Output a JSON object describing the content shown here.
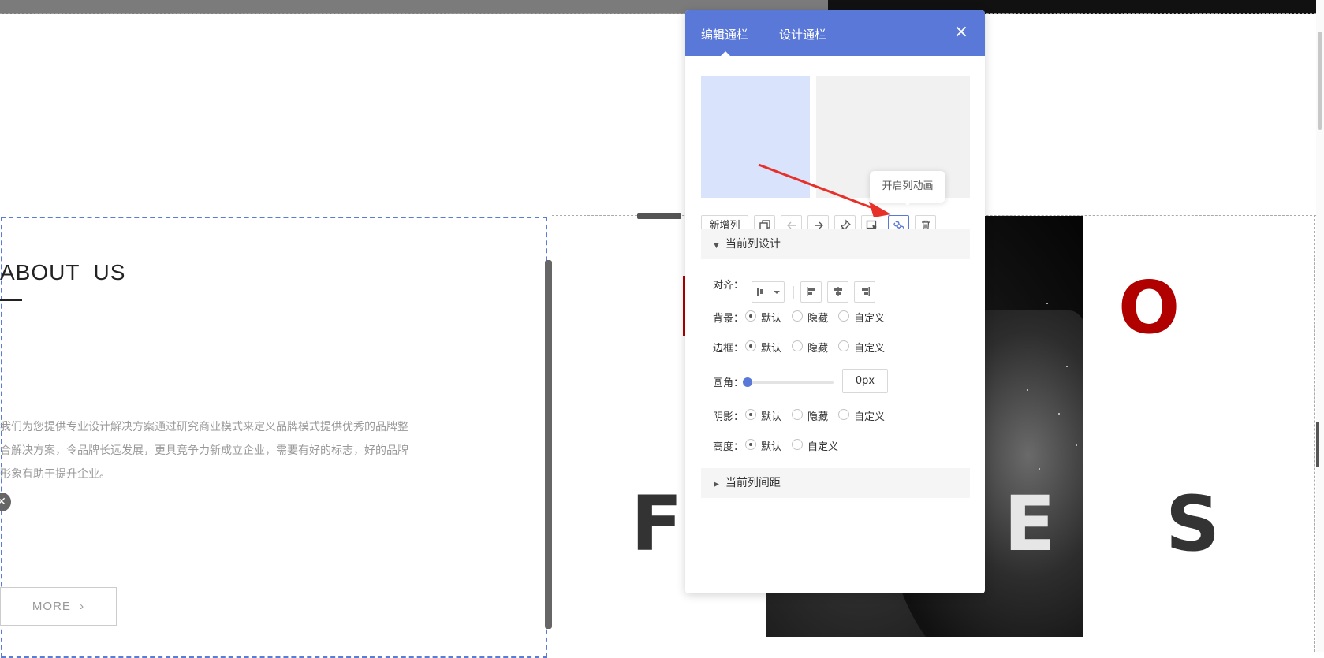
{
  "panel": {
    "tabs": [
      "编辑通栏",
      "设计通栏"
    ],
    "close_icon": "close-icon",
    "tooltip": "开启列动画",
    "add_column": "新增列",
    "toolbar_icons": [
      "copy-icon",
      "arrow-left-icon",
      "arrow-right-icon",
      "pin-icon",
      "select-icon",
      "animation-icon",
      "delete-icon"
    ],
    "current_design_title": "当前列设计",
    "current_spacing_title": "当前列间距",
    "align_label": "对齐：",
    "bg_label": "背景：",
    "border_label": "边框：",
    "radius_label": "圆角：",
    "radius_value": "0px",
    "shadow_label": "阴影：",
    "height_label": "高度：",
    "opt_default": "默认",
    "opt_hidden": "隐藏",
    "opt_custom": "自定义"
  },
  "page": {
    "about_title": "ABOUT  US",
    "about_paragraph": "我们为您提供专业设计解决方案通过研究商业模式来定义品牌模式提供优秀的品牌整合解决方案，令品牌长远发展，更具竞争力新成立企业，需要有好的标志，好的品牌形象有助于提升企业。",
    "more_label": "MORE",
    "big_letters": [
      "O",
      "F",
      "E",
      "S"
    ]
  },
  "colors": {
    "accent": "#5a78d8",
    "red": "#b00000"
  }
}
